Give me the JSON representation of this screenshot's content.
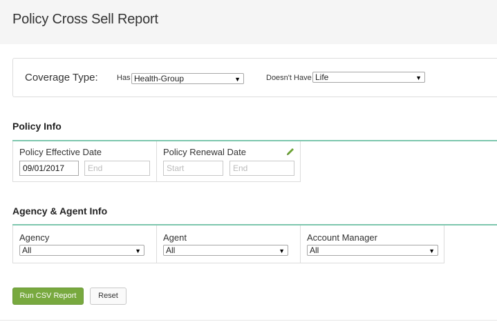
{
  "page": {
    "title": "Policy Cross Sell Report"
  },
  "coverage": {
    "label": "Coverage Type:",
    "has_label": "Has",
    "has_value": "Health-Group",
    "doesnt_have_label": "Doesn't Have",
    "doesnt_have_value": "Life"
  },
  "policy_info": {
    "title": "Policy Info",
    "effective": {
      "label": "Policy Effective Date",
      "start_value": "09/01/2017",
      "end_placeholder": "End"
    },
    "renewal": {
      "label": "Policy Renewal Date",
      "start_placeholder": "Start",
      "end_placeholder": "End"
    },
    "edit_icon": "pencil-icon"
  },
  "agency_info": {
    "title": "Agency & Agent Info",
    "agency": {
      "label": "Agency",
      "value": "All"
    },
    "agent": {
      "label": "Agent",
      "value": "All"
    },
    "account_manager": {
      "label": "Account Manager",
      "value": "All"
    }
  },
  "buttons": {
    "run": "Run CSV Report",
    "reset": "Reset"
  },
  "colors": {
    "accent_line": "#7cc6ad",
    "run_button": "#78a93f",
    "edit_icon": "#6aa232"
  }
}
